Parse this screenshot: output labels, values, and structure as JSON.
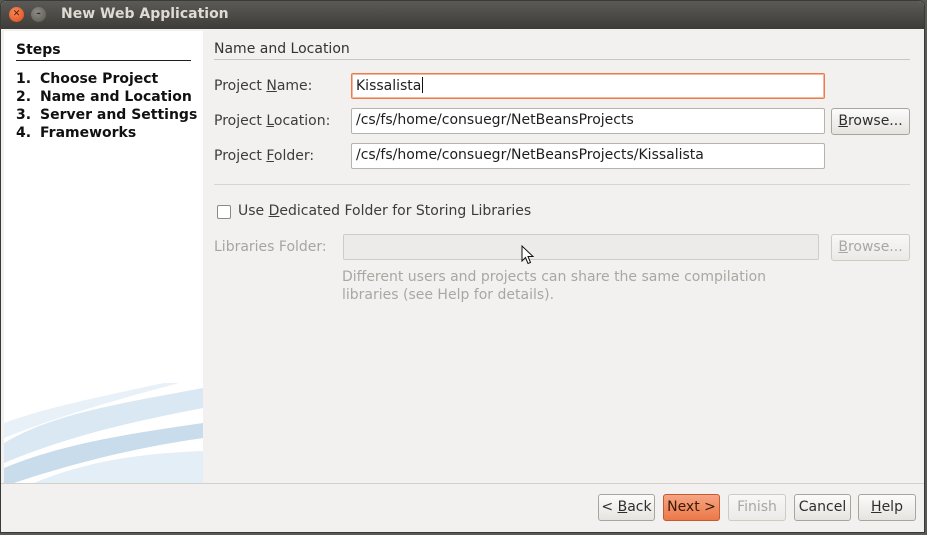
{
  "window": {
    "title": "New Web Application"
  },
  "steps": {
    "heading": "Steps",
    "items": [
      {
        "num": "1.",
        "label": "Choose Project"
      },
      {
        "num": "2.",
        "label": "Name and Location"
      },
      {
        "num": "3.",
        "label": "Server and Settings"
      },
      {
        "num": "4.",
        "label": "Frameworks"
      }
    ]
  },
  "main": {
    "section_title": "Name and Location",
    "project_name": {
      "label_pre": "Project ",
      "label_key": "N",
      "label_post": "ame:",
      "value": "Kissalista"
    },
    "project_location": {
      "label_pre": "Project ",
      "label_key": "L",
      "label_post": "ocation:",
      "value": "/cs/fs/home/consuegr/NetBeansProjects"
    },
    "project_folder": {
      "label_pre": "Project ",
      "label_key": "F",
      "label_post": "older:",
      "value": "/cs/fs/home/consuegr/NetBeansProjects/Kissalista"
    },
    "browse_label_key": "B",
    "browse_label_rest": "rowse...",
    "dedicated_folder": {
      "label_pre": "Use ",
      "label_key": "D",
      "label_post": "edicated Folder for Storing Libraries",
      "checked": false
    },
    "libraries_folder": {
      "label": "Libraries Folder:",
      "value": ""
    },
    "hint_line1": "Different users and projects can share the same compilation",
    "hint_line2": "libraries (see Help for details)."
  },
  "footer": {
    "back": {
      "pre": "< ",
      "key": "B",
      "post": "ack"
    },
    "next": "Next >",
    "finish": "Finish",
    "cancel": "Cancel",
    "help": {
      "key": "H",
      "post": "elp"
    }
  },
  "colors": {
    "accent": "#ec7848",
    "focus_border": "#ef7a4a"
  }
}
